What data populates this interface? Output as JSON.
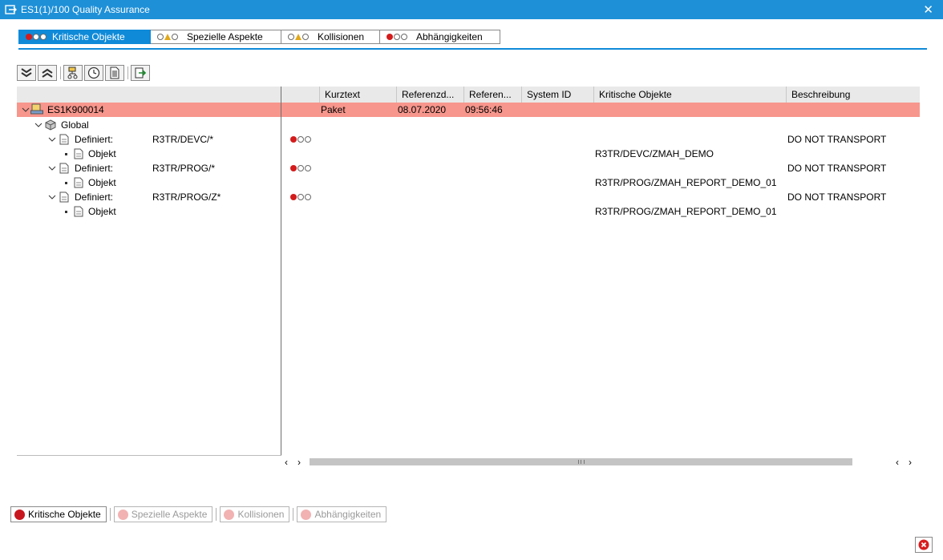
{
  "window": {
    "title": "ES1(1)/100 Quality Assurance",
    "close_glyph": "✕"
  },
  "tabs": [
    {
      "label": "Kritische Objekte",
      "lights": "red-off-off",
      "active": true
    },
    {
      "label": "Spezielle Aspekte",
      "lights": "off-yellow-off",
      "active": false
    },
    {
      "label": "Kollisionen",
      "lights": "off-yellow-off",
      "active": false
    },
    {
      "label": "Abhängigkeiten",
      "lights": "red-off-off",
      "active": false
    }
  ],
  "toolbar": {
    "icons": [
      "expand-all-icon",
      "collapse-all-icon",
      "hierarchy-icon",
      "clock-icon",
      "document-icon",
      "export-icon"
    ]
  },
  "columns": [
    "Kurztext",
    "Referenzd...",
    "Referen...",
    "System ID",
    "Kritische Objekte",
    "Beschreibung"
  ],
  "tree": {
    "root": {
      "label": "ES1K900014",
      "kurztext": "Paket",
      "date": "08.07.2020",
      "time": "09:56:46"
    },
    "global": {
      "label": "Global"
    },
    "definitions": [
      {
        "label": "Definiert:",
        "value": "R3TR/DEVC/*",
        "description": "DO NOT TRANSPORT",
        "child_label": "Objekt",
        "child_object": "R3TR/DEVC/ZMAH_DEMO"
      },
      {
        "label": "Definiert:",
        "value": "R3TR/PROG/*",
        "description": "DO NOT TRANSPORT",
        "child_label": "Objekt",
        "child_object": "R3TR/PROG/ZMAH_REPORT_DEMO_01"
      },
      {
        "label": "Definiert:",
        "value": "R3TR/PROG/Z*",
        "description": "DO NOT TRANSPORT",
        "child_label": "Objekt",
        "child_object": "R3TR/PROG/ZMAH_REPORT_DEMO_01"
      }
    ]
  },
  "scroll": {
    "left_arrow": "‹",
    "right_arrow": "›"
  },
  "legend": [
    {
      "label": "Kritische Objekte",
      "enabled": true
    },
    {
      "label": "Spezielle Aspekte",
      "enabled": false
    },
    {
      "label": "Kollisionen",
      "enabled": false
    },
    {
      "label": "Abhängigkeiten",
      "enabled": false
    }
  ],
  "colors": {
    "accent": "#0f8ad8",
    "titlebar": "#1e90d8",
    "highlight_row": "#f7968c",
    "critical_red": "#d41c1c",
    "warning_yellow": "#e1a81b"
  }
}
